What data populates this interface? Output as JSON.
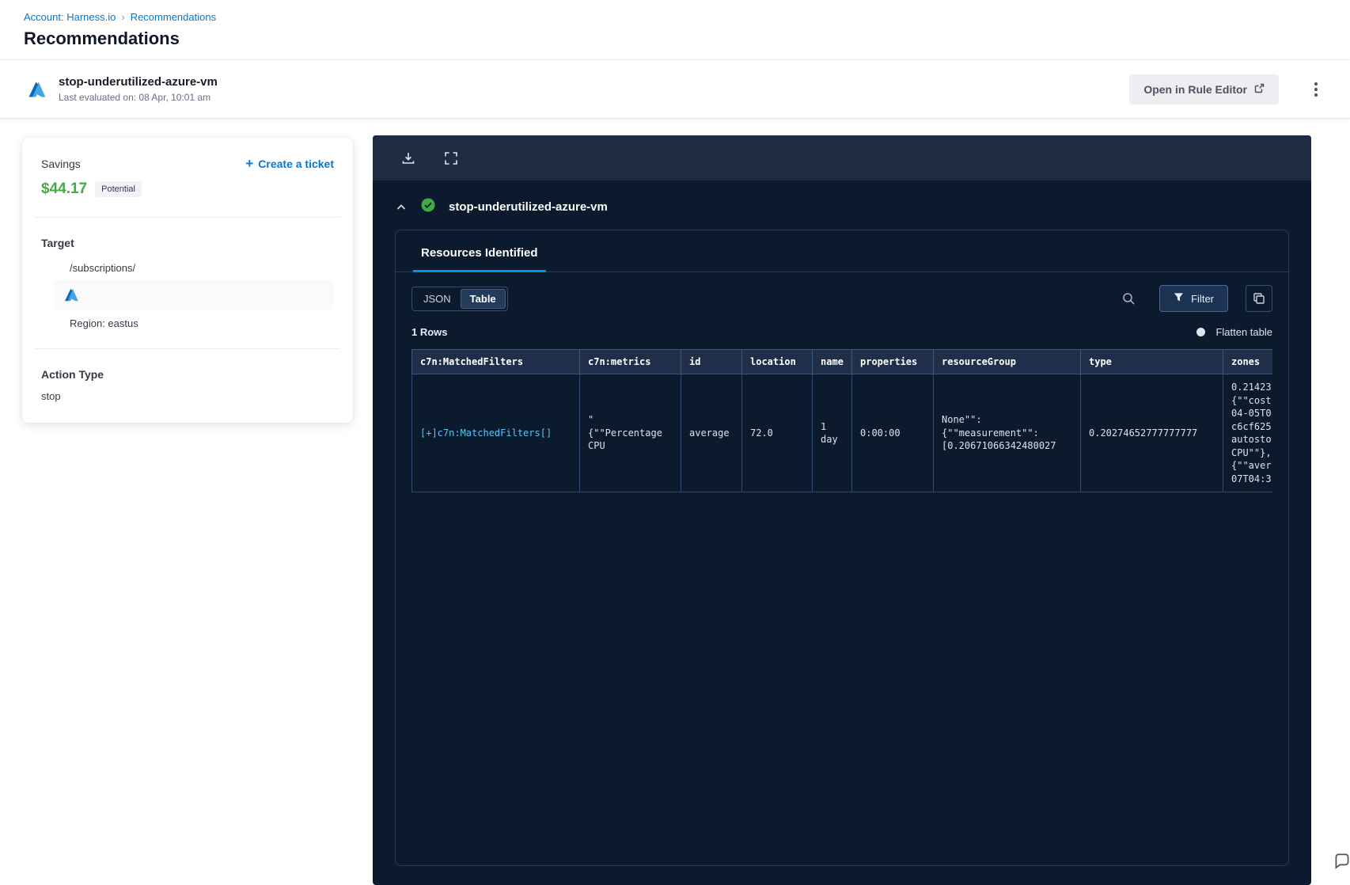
{
  "breadcrumb": {
    "account": "Account: Harness.io",
    "separator": "›",
    "current": "Recommendations"
  },
  "page": {
    "title": "Recommendations"
  },
  "header": {
    "title": "stop-underutilized-azure-vm",
    "subtitle": "Last evaluated on: 08 Apr, 10:01 am",
    "open_rule_editor_label": "Open in Rule Editor"
  },
  "savings_card": {
    "savings_label": "Savings",
    "plus_glyph": "+",
    "create_ticket_label": "Create a ticket",
    "amount": "$44.17",
    "badge": "Potential",
    "target_label": "Target",
    "target_path": "/subscriptions/",
    "region": "Region: eastus",
    "action_type_label": "Action Type",
    "action_type_value": "stop"
  },
  "panel": {
    "title": "stop-underutilized-azure-vm",
    "tab_label": "Resources Identified",
    "view_toggle": {
      "json": "JSON",
      "table": "Table"
    },
    "filter_label": "Filter",
    "rows_count": "1 Rows",
    "flatten_label": "Flatten table",
    "table": {
      "columns": [
        "c7n:MatchedFilters",
        "c7n:metrics",
        "id",
        "location",
        "name",
        "properties",
        "resourceGroup",
        "type",
        "zones"
      ],
      "row": {
        "matched_filters": "[+]c7n:MatchedFilters[]",
        "metrics": "\"\n{\"\"Percentage\nCPU",
        "id": "average",
        "location": "72.0",
        "name": "1\nday",
        "properties": "0:00:00",
        "resource_group": "None\"\":\n{\"\"measurement\"\":\n[0.20671066342480027",
        "type": "0.20274652777777777",
        "zones": "0.21423\n{\"\"cost\n04-05T0\nc6cf625\nautosto\nCPU\"\"},\n{\"\"aver\n07T04:3"
      }
    }
  },
  "colors": {
    "link_blue": "#0278d5",
    "savings_green": "#42ab45",
    "panel_bg": "#0b1a2d",
    "toolbar_bg": "#1d2c42",
    "accent_cyan": "#56c8f5",
    "success_green": "#42ab45",
    "tab_underline": "#0092e4"
  }
}
